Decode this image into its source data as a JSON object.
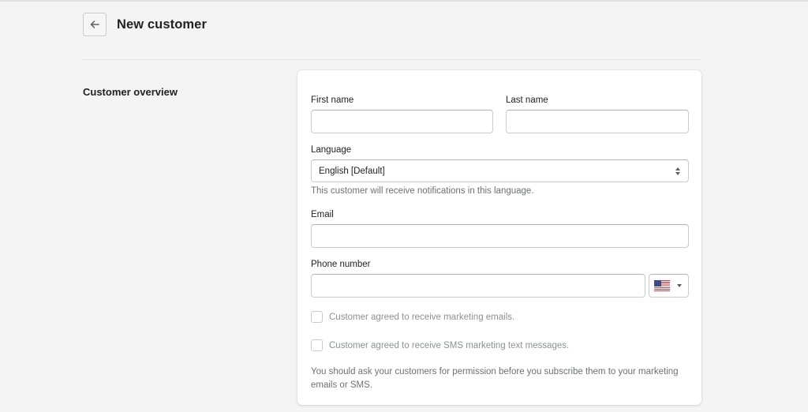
{
  "header": {
    "back_icon": "arrow-left-icon",
    "title": "New customer"
  },
  "section": {
    "title": "Customer overview"
  },
  "form": {
    "first_name": {
      "label": "First name",
      "value": "",
      "placeholder": ""
    },
    "last_name": {
      "label": "Last name",
      "value": "",
      "placeholder": ""
    },
    "language": {
      "label": "Language",
      "selected": "English [Default]",
      "help": "This customer will receive notifications in this language.",
      "icon": "select-updown-icon"
    },
    "email": {
      "label": "Email",
      "value": "",
      "placeholder": ""
    },
    "phone": {
      "label": "Phone number",
      "value": "",
      "placeholder": "",
      "country_flag": "us-flag-icon",
      "country_caret": "caret-down-icon"
    },
    "marketing_email": {
      "label": "Customer agreed to receive marketing emails.",
      "checked": false
    },
    "marketing_sms": {
      "label": "Customer agreed to receive SMS marketing text messages.",
      "checked": false
    },
    "disclaimer": "You should ask your customers for permission before you subscribe them to your marketing emails or SMS."
  },
  "colors": {
    "background": "#f4f4f4",
    "card": "#ffffff",
    "border": "#c9cccf",
    "text": "#202223",
    "subdued": "#6d7175"
  }
}
